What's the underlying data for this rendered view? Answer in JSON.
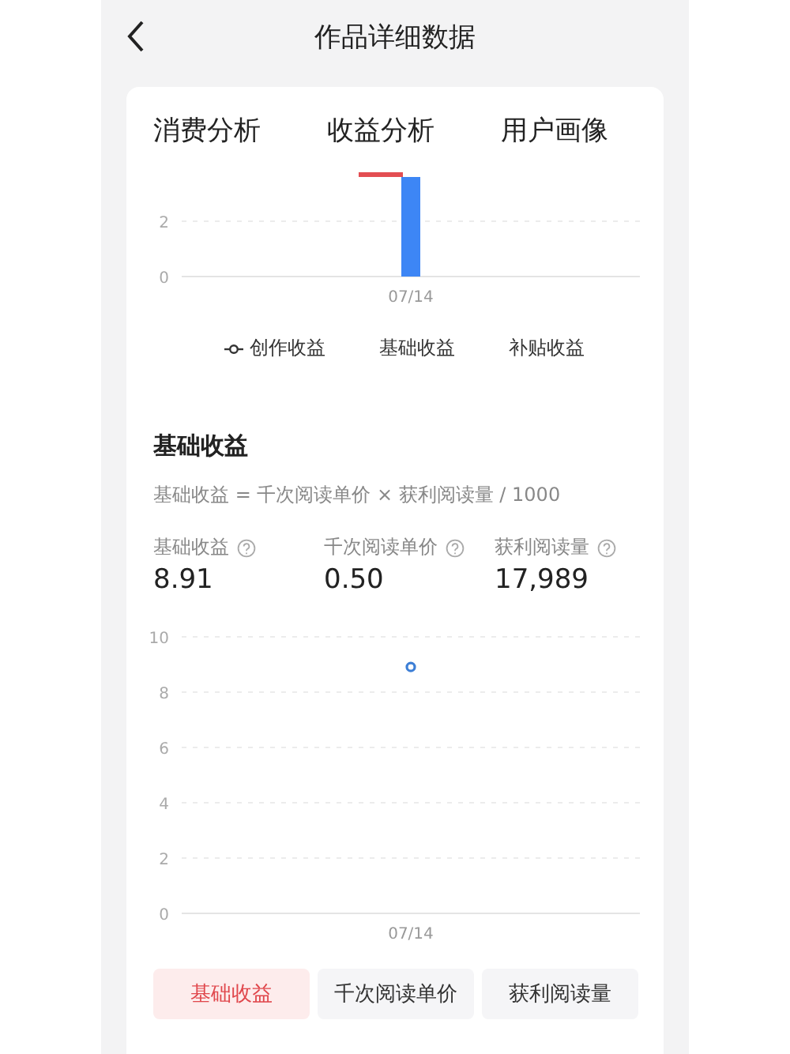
{
  "header": {
    "title": "作品详细数据"
  },
  "tabs": [
    {
      "label": "消费分析",
      "selected": false
    },
    {
      "label": "收益分析",
      "selected": true
    },
    {
      "label": "用户画像",
      "selected": false
    }
  ],
  "top_chart": {
    "y_labels": [
      "2",
      "0"
    ],
    "x_labels": [
      "07/14"
    ],
    "legend": [
      {
        "label": "创作收益",
        "kind": "line"
      },
      {
        "label": "基础收益",
        "kind": "plain"
      },
      {
        "label": "补贴收益",
        "kind": "plain"
      }
    ]
  },
  "basic_income": {
    "title": "基础收益",
    "formula": "基础收益 = 千次阅读单价 × 获利阅读量 / 1000",
    "metrics": [
      {
        "label": "基础收益",
        "value": "8.91"
      },
      {
        "label": "千次阅读单价",
        "value": "0.50"
      },
      {
        "label": "获利阅读量",
        "value": "17,989"
      }
    ],
    "chart_data": {
      "type": "line",
      "categories": [
        "07/14"
      ],
      "ylim": [
        0,
        10
      ],
      "yticks": [
        0,
        2,
        4,
        6,
        8,
        10
      ],
      "grid": true,
      "series": [
        {
          "color": "#3d7fd6",
          "marker": "circle",
          "values": [
            8.91
          ]
        }
      ]
    },
    "toggles": [
      {
        "label": "基础收益",
        "selected": true
      },
      {
        "label": "千次阅读单价",
        "selected": false
      },
      {
        "label": "获利阅读量",
        "selected": false
      }
    ]
  }
}
